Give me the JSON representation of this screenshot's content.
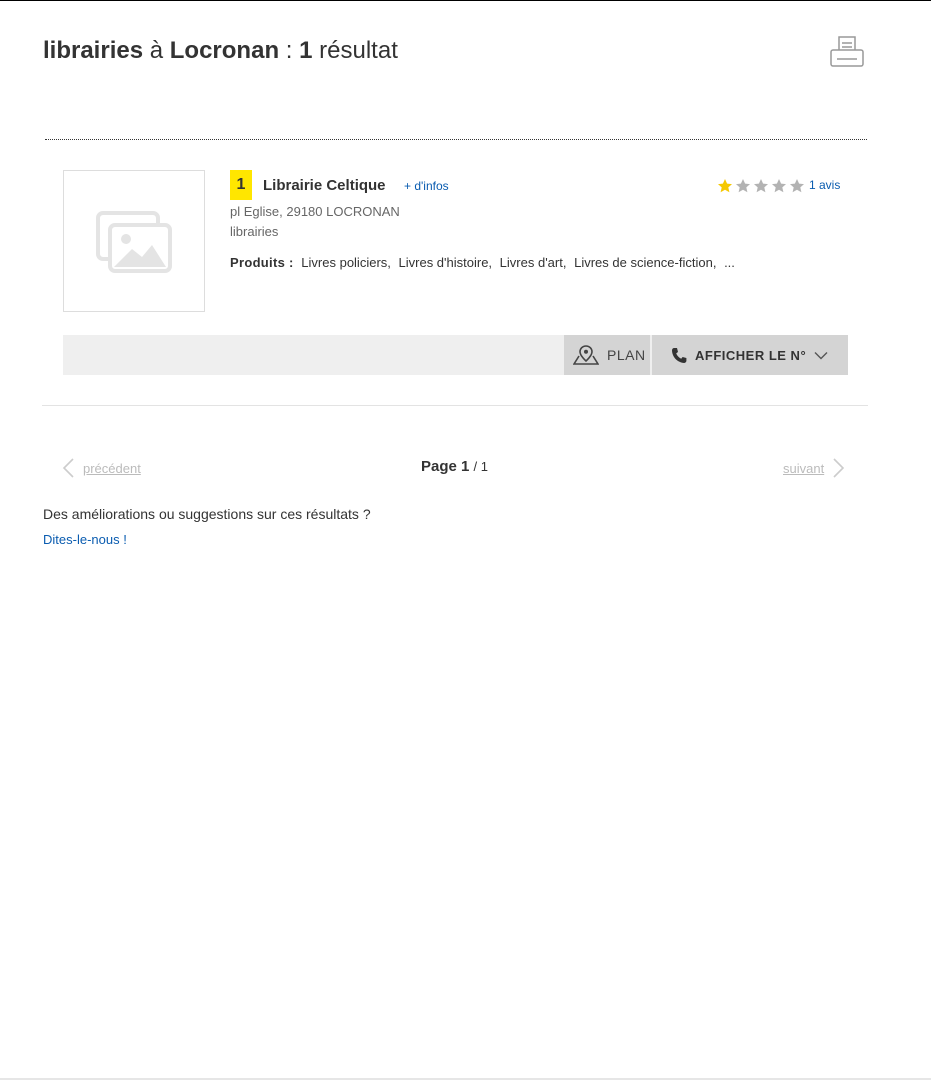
{
  "header": {
    "activity": "librairies",
    "preposition": "à",
    "location": "Locronan",
    "separator": ":",
    "count": "1",
    "count_label": "résultat",
    "print_icon": "print-icon"
  },
  "results": [
    {
      "rank": "1",
      "name": "Librairie Celtique",
      "more_info": "+ d'infos",
      "rating": 1,
      "rating_max": 5,
      "reviews": "1 avis",
      "address": "pl Eglise, 29180 LOCRONAN",
      "category": "librairies",
      "products_label": "Produits :",
      "products": [
        "Livres policiers,",
        "Livres d'histoire,",
        "Livres d'art,",
        "Livres de science-fiction,",
        "..."
      ],
      "plan_label": "PLAN",
      "phone_label": "AFFICHER LE N°",
      "thumbnail_icon": "image-placeholder-icon"
    }
  ],
  "pagination": {
    "prev_label": "précédent",
    "page_word": "Page",
    "current": "1",
    "total": "/ 1",
    "next_label": "suivant"
  },
  "feedback": {
    "question": "Des améliorations ou suggestions sur ces résultats ?",
    "link": "Dites-le-nous !"
  },
  "colors": {
    "badge": "#ffe600",
    "star_on": "#f5c800",
    "star_off": "#b3b3b3",
    "link": "#0a5cb0"
  }
}
